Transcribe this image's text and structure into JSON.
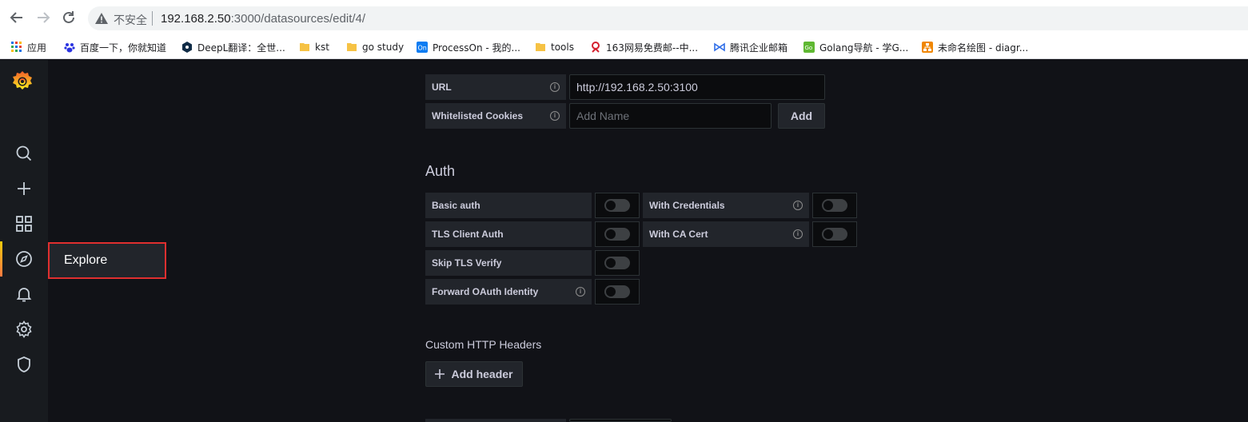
{
  "browser": {
    "insecure_label": "不安全",
    "url_host": "192.168.2.50",
    "url_path": ":3000/datasources/edit/4/"
  },
  "bookmarks": [
    {
      "label": "应用",
      "icon": "apps-grid-icon"
    },
    {
      "label": "百度一下，你就知道",
      "icon": "baidu-icon"
    },
    {
      "label": "DeepL翻译：全世...",
      "icon": "deepl-icon"
    },
    {
      "label": "kst",
      "icon": "folder-icon"
    },
    {
      "label": "go study",
      "icon": "folder-icon"
    },
    {
      "label": "ProcessOn - 我的...",
      "icon": "processon-icon"
    },
    {
      "label": "tools",
      "icon": "folder-icon"
    },
    {
      "label": "163网易免费邮--中...",
      "icon": "netease-icon"
    },
    {
      "label": "腾讯企业邮箱",
      "icon": "tencent-mail-icon"
    },
    {
      "label": "Golang导航 - 学G...",
      "icon": "golang-nav-icon"
    },
    {
      "label": "未命名绘图 - diagr...",
      "icon": "drawio-icon"
    }
  ],
  "sidemenu": {
    "flyout_label": "Explore",
    "items": [
      "search-icon",
      "plus-icon",
      "dashboards-icon",
      "explore-icon",
      "alerting-bell-icon",
      "configuration-gear-icon",
      "server-admin-shield-icon"
    ]
  },
  "http": {
    "url_label": "URL",
    "url_value": "http://192.168.2.50:3100",
    "cookies_label": "Whitelisted Cookies",
    "cookies_placeholder": "Add Name",
    "add_button": "Add"
  },
  "auth": {
    "title": "Auth",
    "basic_auth": "Basic auth",
    "with_credentials": "With Credentials",
    "tls_client_auth": "TLS Client Auth",
    "with_ca_cert": "With CA Cert",
    "skip_tls_verify": "Skip TLS Verify",
    "forward_oauth": "Forward OAuth Identity"
  },
  "headers": {
    "title": "Custom HTTP Headers",
    "add_header_button": "Add header"
  },
  "colors": {
    "background": "#111217",
    "sidemenu": "#181b1f",
    "highlight_border": "#e02f2f",
    "active_accent": "#ff7941"
  }
}
